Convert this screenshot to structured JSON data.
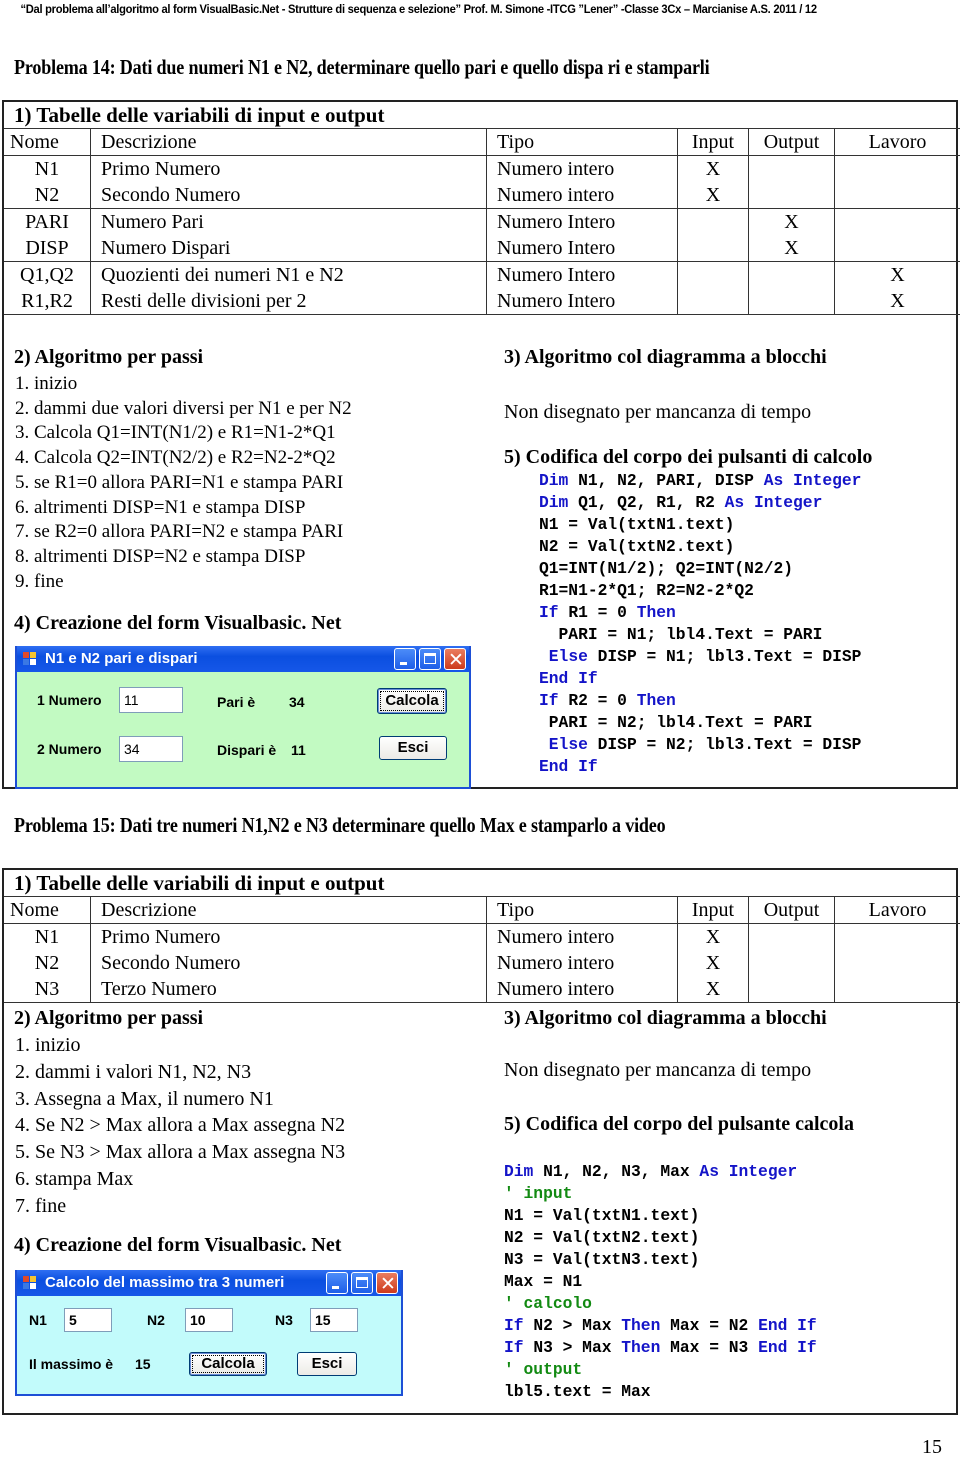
{
  "header": "“Dal problema all’algoritmo al form VisualBasic.Net - Strutture di sequenza e selezione” Prof.  M. Simone  -ITCG ”Lener”  -Classe 3Cx – Marcianise A.S. 2011 / 12",
  "problem14": {
    "title": "Problema 14: Dati due numeri N1 e N2, determinare quello pari e quello dispa ri e stamparli",
    "table": {
      "caption": "1) Tabelle delle variabili di input e output",
      "columns": [
        "Nome",
        "Descrizione",
        "Tipo",
        "Input",
        "Output",
        "Lavoro"
      ],
      "rows": [
        {
          "nome": "N1",
          "descrizione": "Primo Numero",
          "tipo": "Numero intero",
          "input": "X",
          "output": "",
          "lavoro": ""
        },
        {
          "nome": "N2",
          "descrizione": "Secondo Numero",
          "tipo": "Numero intero",
          "input": "X",
          "output": "",
          "lavoro": ""
        },
        {
          "nome": "PARI",
          "descrizione": "Numero Pari",
          "tipo": "Numero Intero",
          "input": "",
          "output": "X",
          "lavoro": ""
        },
        {
          "nome": "DISP",
          "descrizione": "Numero Dispari",
          "tipo": "Numero Intero",
          "input": "",
          "output": "X",
          "lavoro": ""
        },
        {
          "nome": "Q1,Q2",
          "descrizione": "Quozienti dei numeri N1 e N2",
          "tipo": "Numero Intero",
          "input": "",
          "output": "",
          "lavoro": "X"
        },
        {
          "nome": "R1,R2",
          "descrizione": "Resti delle divisioni per 2",
          "tipo": "Numero Intero",
          "input": "",
          "output": "",
          "lavoro": "X"
        }
      ]
    },
    "algo_title": "2) Algoritmo per passi",
    "steps": [
      "1. inizio",
      "2. dammi due valori diversi per N1 e per N2",
      "3. Calcola Q1=INT(N1/2) e R1=N1-2*Q1",
      "4. Calcola Q2=INT(N2/2) e R2=N2-2*Q2",
      "5. se R1=0 allora PARI=N1 e stampa PARI",
      "6. altrimenti DISP=N1 e stampa DISP",
      "7. se R2=0 allora PARI=N2 e stampa PARI",
      "8. altrimenti DISP=N2 e stampa DISP",
      "9. fine"
    ],
    "diagram_title": "3) Algoritmo col diagramma a blocchi",
    "diagram_note": "Non disegnato per mancanza di tempo",
    "code_title": "5) Codifica del corpo dei pulsanti di calcolo",
    "code": [
      [
        {
          "t": "Dim",
          "k": "kw"
        },
        {
          "t": " N1, N2, PARI, DISP "
        },
        {
          "t": "As Integer",
          "k": "kw"
        }
      ],
      [
        {
          "t": "Dim",
          "k": "kw"
        },
        {
          "t": " Q1, Q2, R1, R2 "
        },
        {
          "t": "As Integer",
          "k": "kw"
        }
      ],
      [
        {
          "t": "N1 = Val(txtN1.text)"
        }
      ],
      [
        {
          "t": "N2 = Val(txtN2.text)"
        }
      ],
      [
        {
          "t": "Q1=INT(N1/2); Q2=INT(N2/2)"
        }
      ],
      [
        {
          "t": "R1=N1-2*Q1; R2=N2-2*Q2"
        }
      ],
      [
        {
          "t": "If",
          "k": "kw"
        },
        {
          "t": " R1 = 0 "
        },
        {
          "t": "Then",
          "k": "kw"
        }
      ],
      [
        {
          "t": "  PARI = N1; lbl4.Text = PARI"
        }
      ],
      [
        {
          "t": " "
        },
        {
          "t": "Else",
          "k": "kw"
        },
        {
          "t": " DISP = N1; lbl3.Text = DISP"
        }
      ],
      [
        {
          "t": "End If",
          "k": "kw"
        }
      ],
      [
        {
          "t": "If",
          "k": "kw"
        },
        {
          "t": " R2 = 0 "
        },
        {
          "t": "Then",
          "k": "kw"
        }
      ],
      [
        {
          "t": " PARI = N2; lbl4.Text = PARI"
        }
      ],
      [
        {
          "t": " "
        },
        {
          "t": "Else",
          "k": "kw"
        },
        {
          "t": " DISP = N2; lbl3.Text = DISP"
        }
      ],
      [
        {
          "t": "End If",
          "k": "kw"
        }
      ]
    ],
    "form_title": "4) Creazione del form Visualbasic. Net",
    "form": {
      "window_title": "N1 e N2 pari  e dispari",
      "label1": "1 Numero",
      "input1": "11",
      "label2": "2 Numero",
      "input2": "34",
      "pari_label": "Pari è",
      "pari_value": "34",
      "dispari_label": "Dispari è",
      "dispari_value": "11",
      "calcola": "Calcola",
      "esci": "Esci",
      "bg": "#c2fac2"
    }
  },
  "problem15": {
    "title": "Problema 15: Dati tre numeri N1,N2 e N3 determinare quello Max e stamparlo a video",
    "table": {
      "caption": "1) Tabelle delle variabili di input e output",
      "columns": [
        "Nome",
        "Descrizione",
        "Tipo",
        "Input",
        "Output",
        "Lavoro"
      ],
      "rows": [
        {
          "nome": "N1",
          "descrizione": "Primo Numero",
          "tipo": "Numero intero",
          "input": "X",
          "output": "",
          "lavoro": ""
        },
        {
          "nome": "N2",
          "descrizione": "Secondo Numero",
          "tipo": "Numero intero",
          "input": "X",
          "output": "",
          "lavoro": ""
        },
        {
          "nome": "N3",
          "descrizione": "Terzo Numero",
          "tipo": "Numero intero",
          "input": "X",
          "output": "",
          "lavoro": ""
        }
      ]
    },
    "algo_title": "2) Algoritmo per passi",
    "steps": [
      "1. inizio",
      "2. dammi  i valori N1, N2, N3",
      "3. Assegna a Max, il numero N1",
      "4. Se N2 > Max allora a Max assegna N2",
      "5. Se N3 > Max allora a Max assegna N3",
      "6. stampa Max",
      "7. fine"
    ],
    "diagram_title": "3) Algoritmo col diagramma a blocchi",
    "diagram_note": "Non disegnato per mancanza di tempo",
    "code_title": "5) Codifica del corpo del pulsante calcola",
    "code": [
      [
        {
          "t": "Dim",
          "k": "kw"
        },
        {
          "t": " N1, N2, N3, Max "
        },
        {
          "t": "As Integer",
          "k": "kw"
        }
      ],
      [
        {
          "t": "' input",
          "k": "cm"
        }
      ],
      [
        {
          "t": "N1 = Val(txtN1.text)"
        }
      ],
      [
        {
          "t": "N2 = Val(txtN2.text)"
        }
      ],
      [
        {
          "t": "N3 = Val(txtN3.text)"
        }
      ],
      [
        {
          "t": "Max = N1"
        }
      ],
      [
        {
          "t": "' calcolo",
          "k": "cm"
        }
      ],
      [
        {
          "t": "If",
          "k": "kw"
        },
        {
          "t": " N2 > Max "
        },
        {
          "t": "Then",
          "k": "kw"
        },
        {
          "t": " Max = N2 "
        },
        {
          "t": "End If",
          "k": "kw"
        }
      ],
      [
        {
          "t": "If",
          "k": "kw"
        },
        {
          "t": " N3 > Max "
        },
        {
          "t": "Then",
          "k": "kw"
        },
        {
          "t": " Max = N3 "
        },
        {
          "t": "End If",
          "k": "kw"
        }
      ],
      [
        {
          "t": "' output",
          "k": "cm"
        }
      ],
      [
        {
          "t": "lbl5.text = Max"
        }
      ]
    ],
    "form_title": "4) Creazione del form Visualbasic. Net",
    "form": {
      "window_title": "Calcolo del massimo tra 3 numeri",
      "n1_label": "N1",
      "n1_value": "5",
      "n2_label": "N2",
      "n2_value": "10",
      "n3_label": "N3",
      "n3_value": "15",
      "result_label": "Il massimo è",
      "result_value": "15",
      "calcola": "Calcola",
      "esci": "Esci",
      "bg": "#c2fbfb"
    }
  },
  "page_number": "15"
}
